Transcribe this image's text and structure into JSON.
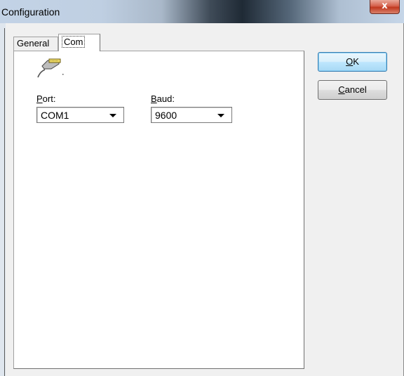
{
  "window": {
    "title": "Configuration",
    "close_glyph": "x"
  },
  "tabs": [
    {
      "label": "General",
      "selected": false
    },
    {
      "label": "Com",
      "selected": true
    }
  ],
  "com": {
    "icon": "serial-cable-icon",
    "port": {
      "label_mnemonic": "P",
      "label_rest": "ort:",
      "value": "COM1"
    },
    "baud": {
      "label_mnemonic": "B",
      "label_rest": "aud:",
      "value": "9600"
    }
  },
  "buttons": {
    "ok": {
      "mnemonic": "O",
      "rest": "K"
    },
    "cancel": {
      "mnemonic": "C",
      "rest": "ancel"
    }
  },
  "colors": {
    "ok_border": "#3c7fb1",
    "close_red": "#c0391f",
    "panel_bg": "#ffffff",
    "dialog_bg": "#f0f0f0"
  }
}
